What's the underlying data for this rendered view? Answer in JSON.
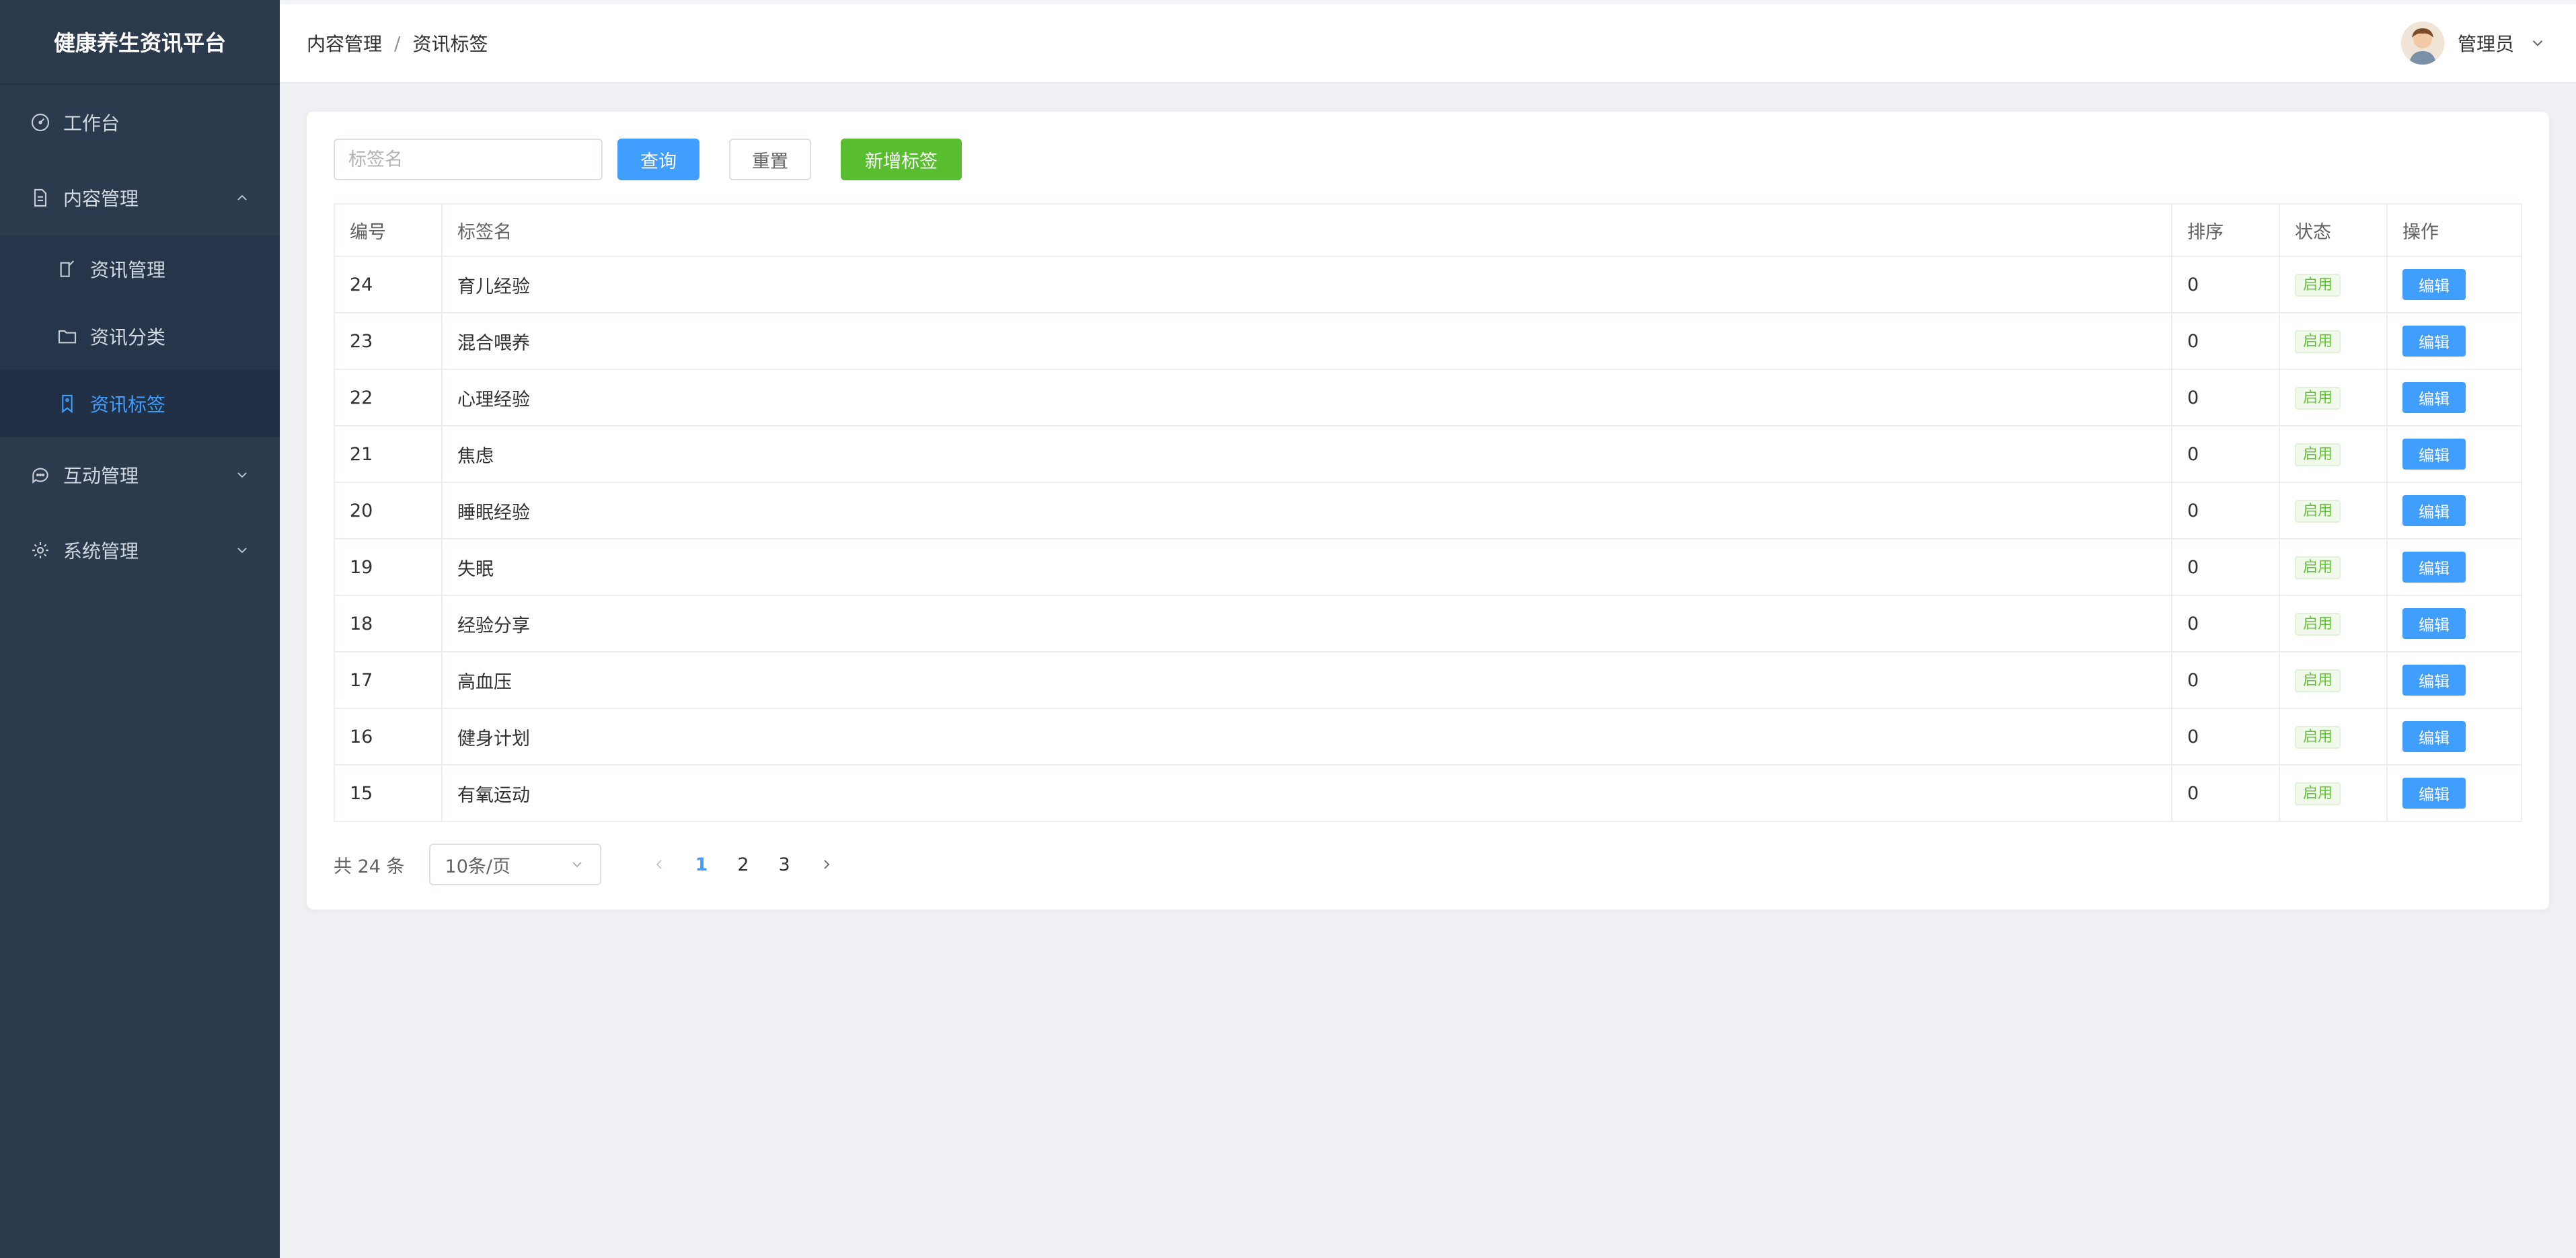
{
  "sidebar": {
    "logo": "健康养生资讯平台",
    "items": [
      {
        "label": "工作台"
      },
      {
        "label": "内容管理"
      },
      {
        "label": "资讯管理"
      },
      {
        "label": "资讯分类"
      },
      {
        "label": "资讯标签"
      },
      {
        "label": "互动管理"
      },
      {
        "label": "系统管理"
      }
    ]
  },
  "header": {
    "breadcrumb": [
      "内容管理",
      "资讯标签"
    ],
    "breadcrumb_sep": "/",
    "user_name": "管理员"
  },
  "toolbar": {
    "search_placeholder": "标签名",
    "search_value": "",
    "query_label": "查询",
    "reset_label": "重置",
    "add_label": "新增标签"
  },
  "table": {
    "columns": [
      "编号",
      "标签名",
      "排序",
      "状态",
      "操作"
    ],
    "rows": [
      {
        "id": "24",
        "name": "育儿经验",
        "sort": "0",
        "status": "启用",
        "action": "编辑"
      },
      {
        "id": "23",
        "name": "混合喂养",
        "sort": "0",
        "status": "启用",
        "action": "编辑"
      },
      {
        "id": "22",
        "name": "心理经验",
        "sort": "0",
        "status": "启用",
        "action": "编辑"
      },
      {
        "id": "21",
        "name": "焦虑",
        "sort": "0",
        "status": "启用",
        "action": "编辑"
      },
      {
        "id": "20",
        "name": "睡眠经验",
        "sort": "0",
        "status": "启用",
        "action": "编辑"
      },
      {
        "id": "19",
        "name": "失眠",
        "sort": "0",
        "status": "启用",
        "action": "编辑"
      },
      {
        "id": "18",
        "name": "经验分享",
        "sort": "0",
        "status": "启用",
        "action": "编辑"
      },
      {
        "id": "17",
        "name": "高血压",
        "sort": "0",
        "status": "启用",
        "action": "编辑"
      },
      {
        "id": "16",
        "name": "健身计划",
        "sort": "0",
        "status": "启用",
        "action": "编辑"
      },
      {
        "id": "15",
        "name": "有氧运动",
        "sort": "0",
        "status": "启用",
        "action": "编辑"
      }
    ]
  },
  "pagination": {
    "total_text": "共 24 条",
    "page_size": "10条/页",
    "pages": [
      "1",
      "2",
      "3"
    ],
    "current": "1"
  },
  "colors": {
    "sidebar_bg": "#2b3a4d",
    "primary": "#409eff",
    "success": "#58bd2f",
    "tag_green": "#67c23a"
  }
}
